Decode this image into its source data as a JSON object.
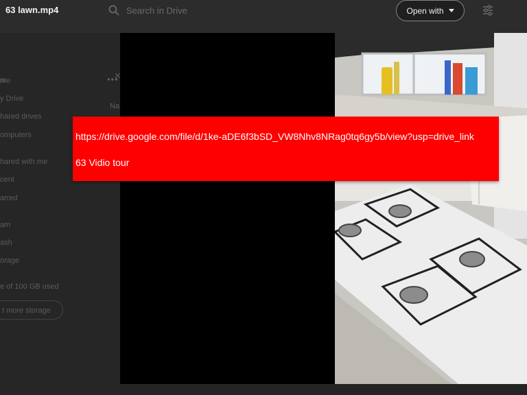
{
  "header": {
    "file_title": "63 lawn.mp4",
    "search_placeholder": "Search in Drive",
    "open_with_label": "Open with"
  },
  "sidebar": {
    "new_label": "w",
    "more_label": "•••",
    "items": [
      {
        "label": "me"
      },
      {
        "label": "y Drive"
      },
      {
        "label": "hared drives"
      },
      {
        "label": "omputers"
      },
      {
        "label": "hared with me"
      },
      {
        "label": "cent"
      },
      {
        "label": "arred"
      },
      {
        "label": "am"
      },
      {
        "label": "ash"
      },
      {
        "label": "orage"
      }
    ],
    "storage_used": "e of 100 GB used",
    "storage_button": "t more storage"
  },
  "main": {
    "column_name": "Na"
  },
  "overlay": {
    "url": "https://drive.google.com/file/d/1ke-aDE6f3bSD_VW8Nhv8NRag0tq6gy5b/view?usp=drive_link",
    "text": "63 Vidio tour"
  },
  "colors": {
    "overlay": "#ff0000",
    "topbar": "#2c2c2c",
    "video_bg": "#000000"
  },
  "icons": [
    "search-icon",
    "chevron-down-icon",
    "filter-icon",
    "close-icon",
    "more-icon"
  ]
}
